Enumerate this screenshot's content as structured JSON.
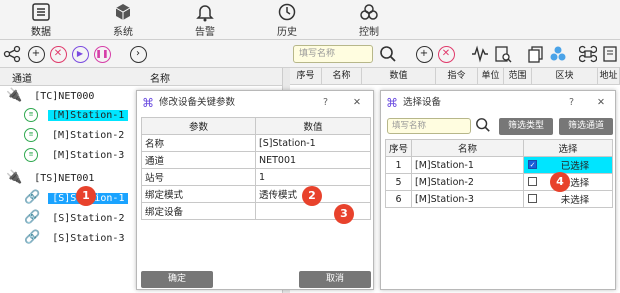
{
  "nav": {
    "items": [
      {
        "label": "数据",
        "icon": "list-icon"
      },
      {
        "label": "系统",
        "icon": "cube-icon"
      },
      {
        "label": "告警",
        "icon": "bell-icon"
      },
      {
        "label": "历史",
        "icon": "history-icon"
      },
      {
        "label": "控制",
        "icon": "control-icon"
      }
    ]
  },
  "toolbar": {
    "search_placeholder": "填写名称"
  },
  "left_panel": {
    "col_channel": "通道",
    "col_name": "名称",
    "groups": [
      {
        "label": "[TC]NET000",
        "items": [
          "[M]Station-1",
          "[M]Station-2",
          "[M]Station-3"
        ]
      },
      {
        "label": "[TS]NET001",
        "items": [
          "[S]Station-1",
          "[S]Station-2",
          "[S]Station-3"
        ]
      }
    ]
  },
  "right_table": {
    "headers": [
      "序号",
      "名称",
      "数值",
      "指令",
      "单位",
      "范围",
      "区块",
      "地址"
    ]
  },
  "dialog_params": {
    "title": "修改设备关键参数",
    "help": "?",
    "close": "✕",
    "headers": [
      "参数",
      "数值"
    ],
    "rows": [
      {
        "param": "名称",
        "value": "[S]Station-1"
      },
      {
        "param": "通道",
        "value": "NET001"
      },
      {
        "param": "站号",
        "value": "1"
      },
      {
        "param": "绑定模式",
        "value": "透传模式"
      },
      {
        "param": "绑定设备",
        "value": ""
      }
    ],
    "ok": "确定",
    "cancel": "取消"
  },
  "dialog_select": {
    "title": "选择设备",
    "help": "?",
    "close": "✕",
    "search_placeholder": "填写名称",
    "filter_type": "筛选类型",
    "filter_channel": "筛选通道",
    "headers": [
      "序号",
      "名称",
      "选择"
    ],
    "rows": [
      {
        "no": "1",
        "name": "[M]Station-1",
        "state": "已选择",
        "checked": true
      },
      {
        "no": "5",
        "name": "[M]Station-2",
        "state": "未选择",
        "checked": false
      },
      {
        "no": "6",
        "name": "[M]Station-3",
        "state": "未选择",
        "checked": false
      }
    ]
  },
  "badges": [
    "1",
    "2",
    "3",
    "4"
  ],
  "colors": {
    "selection": "#1aa3ff",
    "highlight": "#00e5ff",
    "badge": "#e8422c",
    "search_bg": "#fffde0"
  }
}
